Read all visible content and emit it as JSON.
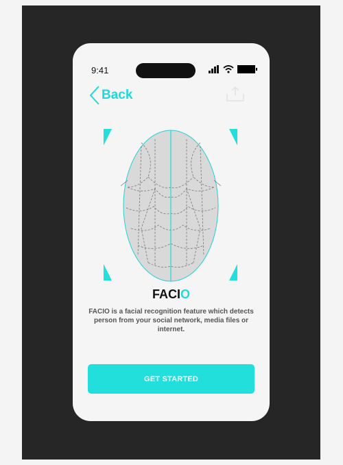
{
  "status_bar": {
    "time": "9:41"
  },
  "nav": {
    "back_label": "Back"
  },
  "brand": {
    "name_main": "FACI",
    "name_accent": "O"
  },
  "description": "FACIO is a facial recognition feature which detects person from your social network, media files or internet.",
  "cta": {
    "label": "GET STARTED"
  },
  "colors": {
    "accent": "#22dfdc",
    "frame": "#262626",
    "screen": "#f5f5f5"
  }
}
